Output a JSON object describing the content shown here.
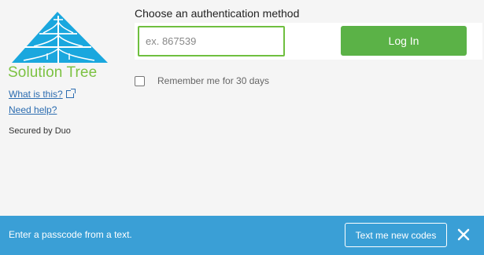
{
  "brand": {
    "name": "Solution Tree",
    "logo_icon": "solution-tree-logo"
  },
  "left": {
    "what_is_this": "What is this?",
    "need_help": "Need help?",
    "secured_by": "Secured by Duo"
  },
  "auth": {
    "title": "Choose an authentication method",
    "passcode_placeholder": "ex. 867539",
    "passcode_value": "",
    "login_label": "Log In",
    "remember_label": "Remember me for 30 days"
  },
  "notice": {
    "message": "Enter a passcode from a text.",
    "action_label": "Text me new codes",
    "close_icon": "close-icon"
  },
  "colors": {
    "brand_green": "#7cc242",
    "logo_blue": "#1aa7de",
    "button_green": "#5bb247",
    "bar_blue": "#3a9fd6",
    "link_blue": "#2b6cb0"
  }
}
